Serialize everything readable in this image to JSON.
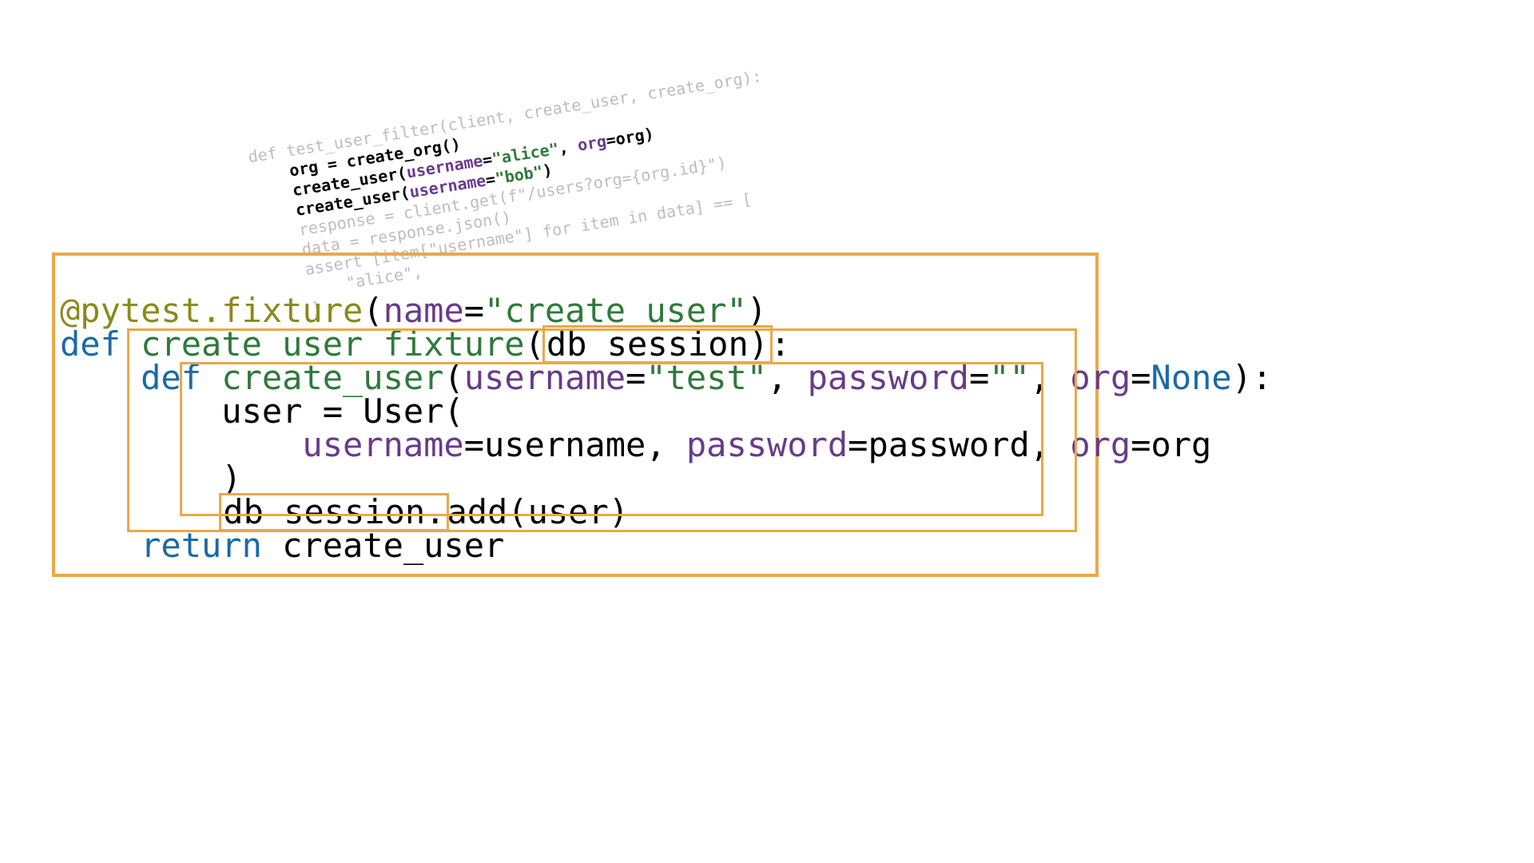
{
  "colors": {
    "highlight_border": "#eaa84a",
    "kw": "#1a6aa8",
    "fn": "#2f7a3a",
    "param": "#6a3a8a",
    "str": "#2f7a3a",
    "dim": "#bdbdbd",
    "decorator": "#8a8a1a"
  },
  "small_snippet": {
    "lines": {
      "l1_a": "def",
      "l1_b": " test_user_filter(client, create_user, create_org):",
      "l2": "    org = create_org()",
      "l3_a": "    create_user(",
      "l3_b": "username",
      "l3_c": "=",
      "l3_d": "\"alice\"",
      "l3_e": ", ",
      "l3_f": "org",
      "l3_g": "=org)",
      "l4_a": "    create_user(",
      "l4_b": "username",
      "l4_c": "=",
      "l4_d": "\"bob\"",
      "l4_e": ")",
      "l5": "    response = client.get(f\"/users?org={org.id}\")",
      "l6": "    data = response.json()",
      "l7": "    assert [item[\"username\"] for item in data] == [",
      "l8": "        \"alice\",",
      "l9": "    ]"
    }
  },
  "big_snippet": {
    "l1_a": "@pytest.fixture",
    "l1_b": "(",
    "l1_c": "name",
    "l1_d": "=",
    "l1_e": "\"create_user\"",
    "l1_f": ")",
    "l2_a": "def",
    "l2_b": " ",
    "l2_c": "create_user_fixture",
    "l2_d": "(",
    "l2_e": "db_session",
    "l2_f": ")",
    "l2_g": ":",
    "l3_a": "def",
    "l3_b": " ",
    "l3_c": "create_user",
    "l3_d": "(",
    "l3_e": "username",
    "l3_f": "=",
    "l3_g": "\"test\"",
    "l3_h": ", ",
    "l3_i": "password",
    "l3_j": "=",
    "l3_k": "\"\"",
    "l3_l": ", ",
    "l3_m": "org",
    "l3_n": "=",
    "l3_o": "None",
    "l3_p": "):",
    "l4": "user = User(",
    "l5_a": "username",
    "l5_b": "=username, ",
    "l5_c": "password",
    "l5_d": "=password, ",
    "l5_e": "org",
    "l5_f": "=org",
    "l6": ")",
    "l7": "db_session.",
    "l7b": "add(user)",
    "l8_a": "return",
    "l8_b": " create_user"
  }
}
